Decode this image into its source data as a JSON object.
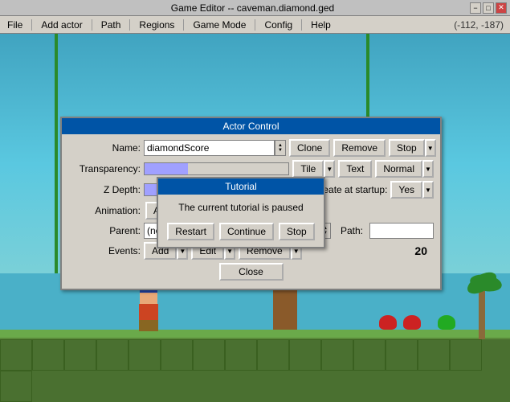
{
  "window": {
    "title": "Game Editor -- caveman.diamond.ged",
    "min_label": "−",
    "max_label": "□",
    "close_label": "✕",
    "coords": "(-112, -187)"
  },
  "menu": {
    "items": [
      "File",
      "Add actor",
      "Path",
      "Regions",
      "Game Mode",
      "Config",
      "Help"
    ]
  },
  "actor_dialog": {
    "title": "Actor Control",
    "name_label": "Name:",
    "name_value": "diamondScore",
    "transparency_label": "Transparency:",
    "zdepth_label": "Z Depth:",
    "animation_label": "Animation:",
    "parent_label": "Parent:",
    "parent_value": "(none)",
    "events_label": "Events:",
    "events_count": "20",
    "path_label": "Path:",
    "buttons": {
      "clone": "Clone",
      "remove": "Remove",
      "stop": "Stop",
      "tile": "Tile",
      "text": "Text",
      "normal": "Normal",
      "create_at_startup": "Create at startup:",
      "yes": "Yes",
      "add_animation": "Add Animation",
      "add_event": "Add",
      "edit_event": "Edit",
      "remove_event": "Remove",
      "close": "Close"
    }
  },
  "tutorial_dialog": {
    "title": "Tutorial",
    "message": "The current tutorial is paused",
    "buttons": {
      "restart": "Restart",
      "continue": "Continue",
      "stop": "Stop"
    }
  }
}
